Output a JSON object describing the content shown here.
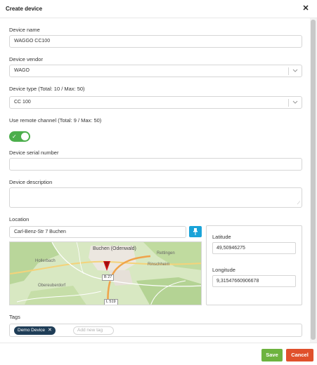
{
  "dialog": {
    "title": "Create device",
    "close_glyph": "✕"
  },
  "fields": {
    "device_name": {
      "label": "Device name",
      "value": "WAGGO CC100"
    },
    "device_vendor": {
      "label": "Device vendor",
      "value": "WAGO"
    },
    "device_type": {
      "label": "Device type (Total: 10 / Max: 50)",
      "value": "CC 100"
    },
    "remote_channel": {
      "label": "Use remote channel (Total: 9 / Max: 50)",
      "enabled": true
    },
    "serial_number": {
      "label": "Device serial number",
      "value": ""
    },
    "description": {
      "label": "Device description",
      "value": ""
    },
    "location": {
      "label": "Location",
      "value": "Carl-Benz-Str 7 Buchen",
      "latitude_label": "Latitude",
      "latitude": "49,50946275",
      "longitude_label": "Longitude",
      "longitude": "9,31547660906678"
    },
    "tags": {
      "label": "Tags",
      "items": [
        "Demo Device"
      ],
      "placeholder": "Add new tag"
    }
  },
  "map": {
    "labels": {
      "buchen": "Buchen (Odenwald)",
      "hollerbach": "Hollerbach",
      "rinschheim": "Rinschheim",
      "rettingen": "Rettingen",
      "obereuberdorf": "Obereuberdorf",
      "b27": "B 27",
      "l519": "L 519"
    }
  },
  "footer": {
    "save_label": "Save",
    "cancel_label": "Cancel"
  },
  "colors": {
    "toggle_on": "#4cae4c",
    "pin_button": "#1aa3d8",
    "tag_chip": "#1f3d57",
    "save": "#6db33f",
    "cancel": "#e0502b",
    "map_marker": "#cc1111"
  },
  "icons": {
    "close": "close-icon",
    "chevron": "chevron-down-icon",
    "pin": "pin-icon",
    "check": "check-icon",
    "marker": "map-marker-icon"
  }
}
